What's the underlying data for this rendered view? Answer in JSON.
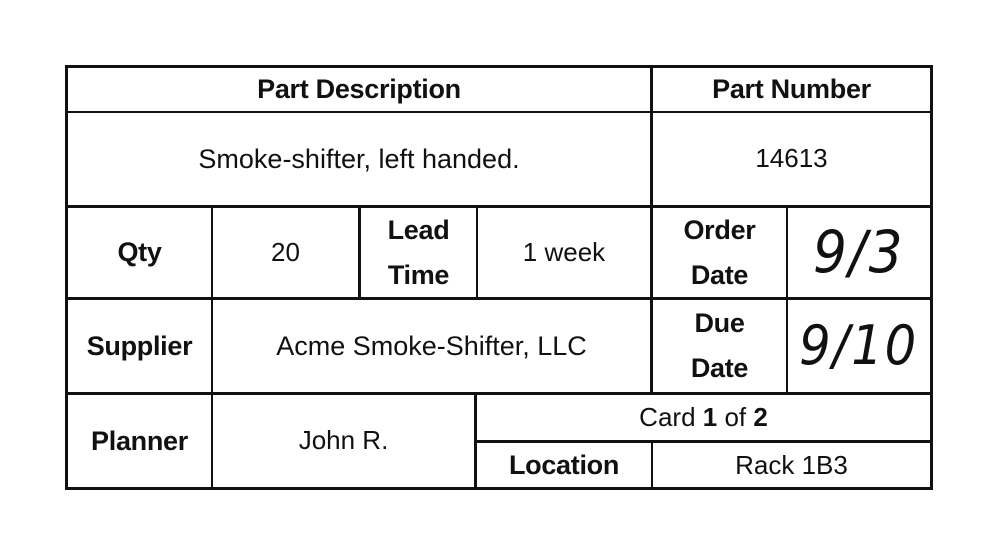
{
  "card": {
    "part_description_label": "Part Description",
    "part_description_value": "Smoke-shifter, left handed.",
    "part_number_label": "Part Number",
    "part_number_value": "14613",
    "qty_label": "Qty",
    "qty_value": "20",
    "lead_time_label_line1": "Lead",
    "lead_time_label_line2": "Time",
    "lead_time_value": "1 week",
    "order_date_label_line1": "Order",
    "order_date_label_line2": "Date",
    "order_date_value": "9/3",
    "supplier_label": "Supplier",
    "supplier_value": "Acme Smoke-Shifter, LLC",
    "due_date_label_line1": "Due",
    "due_date_label_line2": "Date",
    "due_date_value": "9/10",
    "planner_label": "Planner",
    "planner_value": "John R.",
    "card_count": {
      "prefix": "Card ",
      "current": "1",
      "middle": " of ",
      "total": "2"
    },
    "location_label": "Location",
    "location_value": "Rack 1B3"
  }
}
